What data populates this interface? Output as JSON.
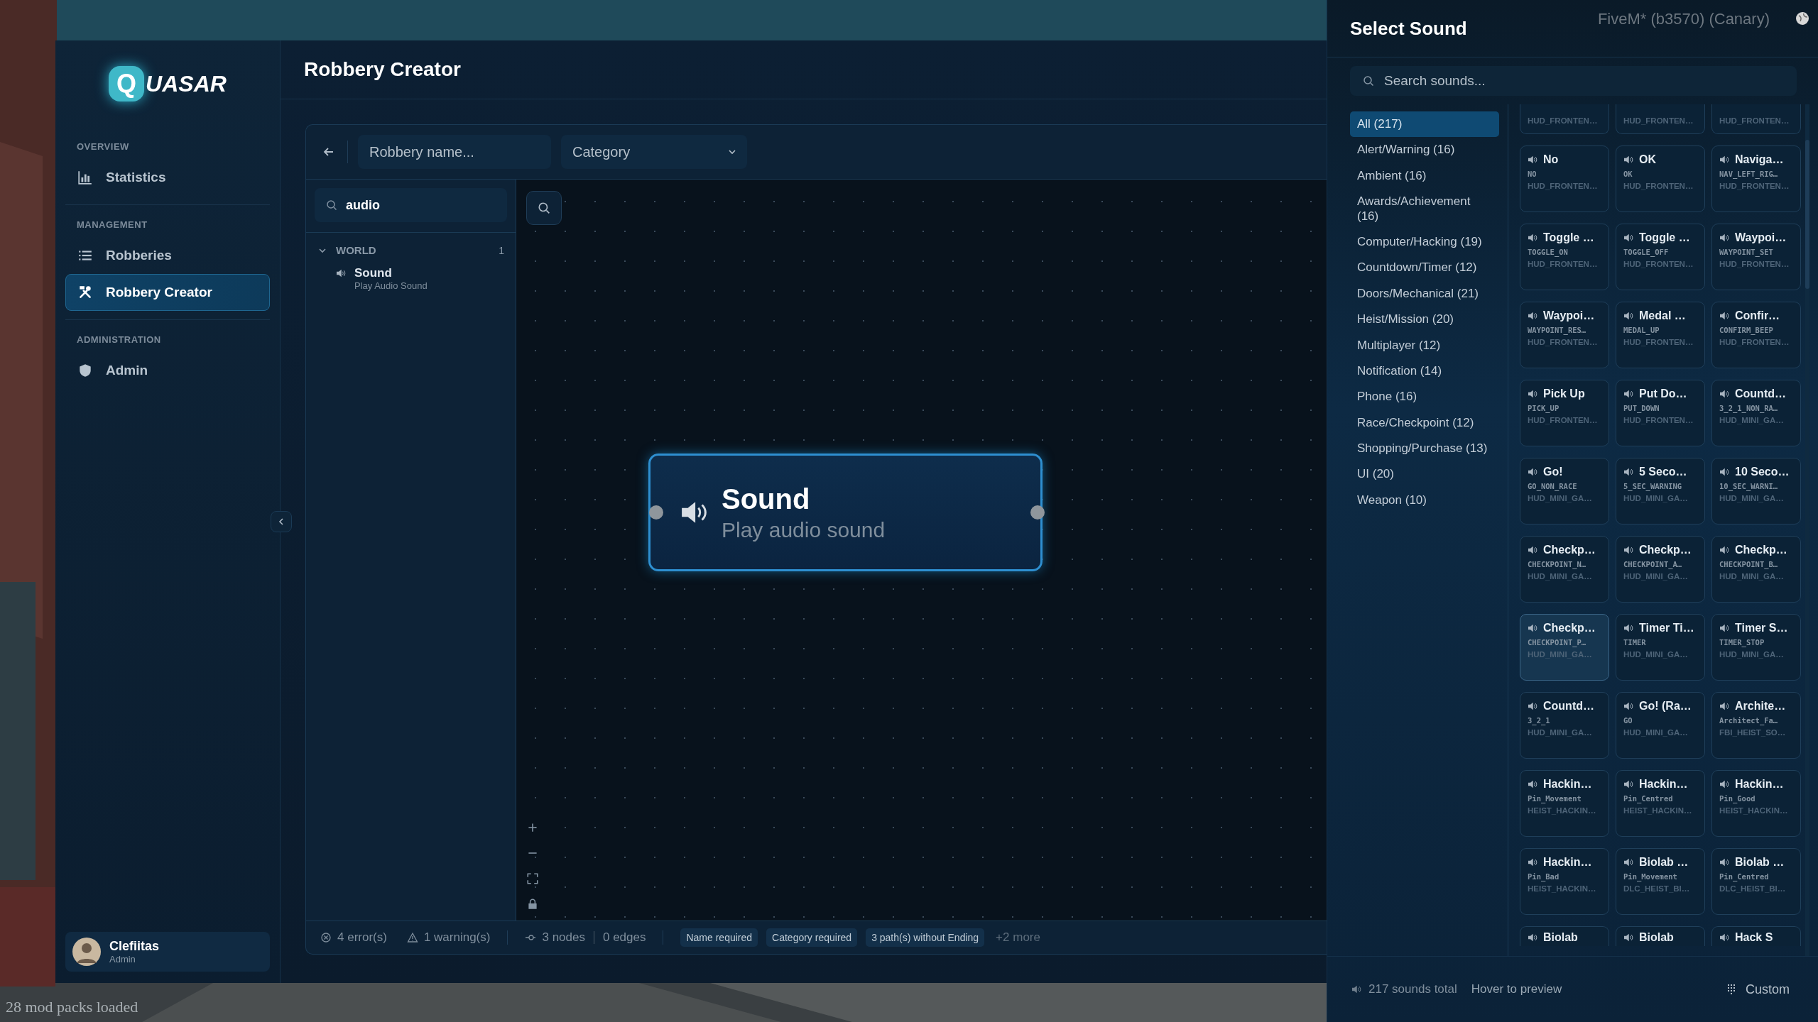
{
  "overlay": {
    "build_label": "FiveM* (b3570) (Canary)",
    "status_text": "28 mod packs loaded"
  },
  "sidebar": {
    "logo_mark": "Q",
    "logo_text": "UASAR",
    "sections": [
      {
        "heading": "OVERVIEW",
        "items": [
          {
            "label": "Statistics",
            "selected": false
          }
        ]
      },
      {
        "heading": "MANAGEMENT",
        "items": [
          {
            "label": "Robberies",
            "selected": false
          },
          {
            "label": "Robbery Creator",
            "selected": true
          }
        ]
      },
      {
        "heading": "ADMINISTRATION",
        "items": [
          {
            "label": "Admin",
            "selected": false
          }
        ]
      }
    ],
    "user": {
      "name": "Clefiitas",
      "role": "Admin"
    }
  },
  "header": {
    "title": "Robbery Creator"
  },
  "editor": {
    "name_placeholder": "Robbery name...",
    "category_placeholder": "Category",
    "palette_search": "audio",
    "groups": [
      {
        "name": "WORLD",
        "count": "1",
        "expanded": true,
        "items": [
          {
            "title": "Sound",
            "subtitle": "Play Audio Sound"
          }
        ]
      }
    ],
    "node": {
      "title": "Sound",
      "subtitle": "Play audio sound"
    },
    "status": {
      "errors": "4 error(s)",
      "warnings": "1 warning(s)",
      "nodes": "3 nodes",
      "edges": "0 edges",
      "issues": [
        "Name required",
        "Category required",
        "3 path(s) without Ending"
      ],
      "more": "+2 more"
    }
  },
  "drawer": {
    "title": "Select Sound",
    "search_placeholder": "Search sounds...",
    "categories": [
      {
        "label": "All (217)",
        "selected": true
      },
      {
        "label": "Alert/Warning (16)",
        "selected": false
      },
      {
        "label": "Ambient (16)",
        "selected": false
      },
      {
        "label": "Awards/Achievement (16)",
        "selected": false
      },
      {
        "label": "Computer/Hacking (19)",
        "selected": false
      },
      {
        "label": "Countdown/Timer (12)",
        "selected": false
      },
      {
        "label": "Doors/Mechanical (21)",
        "selected": false
      },
      {
        "label": "Heist/Mission (20)",
        "selected": false
      },
      {
        "label": "Multiplayer (12)",
        "selected": false
      },
      {
        "label": "Notification (14)",
        "selected": false
      },
      {
        "label": "Phone (16)",
        "selected": false
      },
      {
        "label": "Race/Checkpoint (12)",
        "selected": false
      },
      {
        "label": "Shopping/Purchase (13)",
        "selected": false
      },
      {
        "label": "UI (20)",
        "selected": false
      },
      {
        "label": "Weapon (10)",
        "selected": false
      }
    ],
    "sounds": [
      {
        "kind": "cut_top",
        "bank": "HUD_FRONTEN…"
      },
      {
        "kind": "cut_top",
        "bank": "HUD_FRONTEN…"
      },
      {
        "kind": "cut_top",
        "bank": "HUD_FRONTEN…"
      },
      {
        "kind": "full",
        "title": "No",
        "name": "NO",
        "bank": "HUD_FRONTEN…",
        "hovered": false
      },
      {
        "kind": "full",
        "title": "OK",
        "name": "OK",
        "bank": "HUD_FRONTEN…",
        "hovered": false
      },
      {
        "kind": "full",
        "title": "Naviga…",
        "name": "NAV_LEFT_RIG…",
        "bank": "HUD_FRONTEN…",
        "hovered": false
      },
      {
        "kind": "full",
        "title": "Toggle …",
        "name": "TOGGLE_ON",
        "bank": "HUD_FRONTEN…",
        "hovered": false
      },
      {
        "kind": "full",
        "title": "Toggle …",
        "name": "TOGGLE_OFF",
        "bank": "HUD_FRONTEN…",
        "hovered": false
      },
      {
        "kind": "full",
        "title": "Waypoi…",
        "name": "WAYPOINT_SET",
        "bank": "HUD_FRONTEN…",
        "hovered": false
      },
      {
        "kind": "full",
        "title": "Waypoi…",
        "name": "WAYPOINT_RES…",
        "bank": "HUD_FRONTEN…",
        "hovered": false
      },
      {
        "kind": "full",
        "title": "Medal …",
        "name": "MEDAL_UP",
        "bank": "HUD_FRONTEN…",
        "hovered": false
      },
      {
        "kind": "full",
        "title": "Confir…",
        "name": "CONFIRM_BEEP",
        "bank": "HUD_FRONTEN…",
        "hovered": false
      },
      {
        "kind": "full",
        "title": "Pick Up",
        "name": "PICK_UP",
        "bank": "HUD_FRONTEN…",
        "hovered": false
      },
      {
        "kind": "full",
        "title": "Put Do…",
        "name": "PUT_DOWN",
        "bank": "HUD_FRONTEN…",
        "hovered": false
      },
      {
        "kind": "full",
        "title": "Countd…",
        "name": "3_2_1_NON_RA…",
        "bank": "HUD_MINI_GA…",
        "hovered": false
      },
      {
        "kind": "full",
        "title": "Go!",
        "name": "GO_NON_RACE",
        "bank": "HUD_MINI_GA…",
        "hovered": false
      },
      {
        "kind": "full",
        "title": "5 Seco…",
        "name": "5_SEC_WARNING",
        "bank": "HUD_MINI_GA…",
        "hovered": false
      },
      {
        "kind": "full",
        "title": "10 Seco…",
        "name": "10_SEC_WARNI…",
        "bank": "HUD_MINI_GA…",
        "hovered": false
      },
      {
        "kind": "full",
        "title": "Checkp…",
        "name": "CHECKPOINT_N…",
        "bank": "HUD_MINI_GA…",
        "hovered": false
      },
      {
        "kind": "full",
        "title": "Checkp…",
        "name": "CHECKPOINT_A…",
        "bank": "HUD_MINI_GA…",
        "hovered": false
      },
      {
        "kind": "full",
        "title": "Checkp…",
        "name": "CHECKPOINT_B…",
        "bank": "HUD_MINI_GA…",
        "hovered": false
      },
      {
        "kind": "full",
        "title": "Checkp…",
        "name": "CHECKPOINT_P…",
        "bank": "HUD_MINI_GA…",
        "hovered": true
      },
      {
        "kind": "full",
        "title": "Timer Ti…",
        "name": "TIMER",
        "bank": "HUD_MINI_GA…",
        "hovered": false
      },
      {
        "kind": "full",
        "title": "Timer S…",
        "name": "TIMER_STOP",
        "bank": "HUD_MINI_GA…",
        "hovered": false
      },
      {
        "kind": "full",
        "title": "Countd…",
        "name": "3_2_1",
        "bank": "HUD_MINI_GA…",
        "hovered": false
      },
      {
        "kind": "full",
        "title": "Go! (Ra…",
        "name": "GO",
        "bank": "HUD_MINI_GA…",
        "hovered": false
      },
      {
        "kind": "full",
        "title": "Archite…",
        "name": "Architect_Fa…",
        "bank": "FBI_HEIST_SO…",
        "hovered": false
      },
      {
        "kind": "full",
        "title": "Hackin…",
        "name": "Pin_Movement",
        "bank": "HEIST_HACKIN…",
        "hovered": false
      },
      {
        "kind": "full",
        "title": "Hackin…",
        "name": "Pin_Centred",
        "bank": "HEIST_HACKIN…",
        "hovered": false
      },
      {
        "kind": "full",
        "title": "Hackin…",
        "name": "Pin_Good",
        "bank": "HEIST_HACKIN…",
        "hovered": false
      },
      {
        "kind": "full",
        "title": "Hackin…",
        "name": "Pin_Bad",
        "bank": "HEIST_HACKIN…",
        "hovered": false
      },
      {
        "kind": "full",
        "title": "Biolab …",
        "name": "Pin_Movement",
        "bank": "DLC_HEIST_BI…",
        "hovered": false
      },
      {
        "kind": "full",
        "title": "Biolab …",
        "name": "Pin_Centred",
        "bank": "DLC_HEIST_BI…",
        "hovered": false
      },
      {
        "kind": "cut_bottom",
        "title": "Biolab"
      },
      {
        "kind": "cut_bottom",
        "title": "Biolab"
      },
      {
        "kind": "cut_bottom",
        "title": "Hack S"
      }
    ],
    "footer": {
      "total": "217 sounds total",
      "hint": "Hover to preview",
      "custom": "Custom"
    }
  }
}
